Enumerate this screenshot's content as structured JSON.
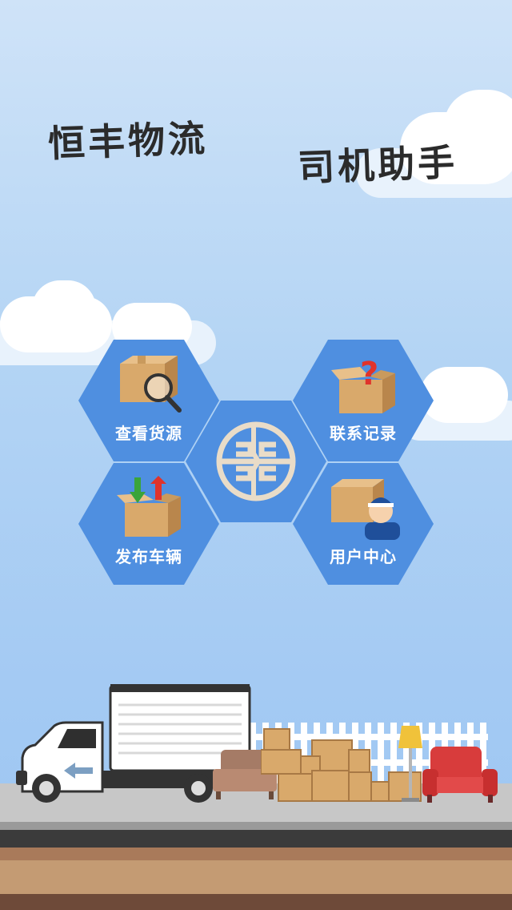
{
  "app": {
    "title_left": "恒丰物流",
    "title_right": "司机助手"
  },
  "menu": {
    "items": [
      {
        "label": "查看货源",
        "icon": "box-magnifier-icon"
      },
      {
        "label": "联系记录",
        "icon": "box-question-icon"
      },
      {
        "label": "发布车辆",
        "icon": "box-arrows-icon"
      },
      {
        "label": "用户中心",
        "icon": "box-driver-icon"
      }
    ],
    "center_icon": "logo-emblem-icon"
  },
  "colors": {
    "hex_blue": "#4f8fe0",
    "sky_top": "#cfe3f8",
    "sky_bottom": "#9cc6f2"
  }
}
